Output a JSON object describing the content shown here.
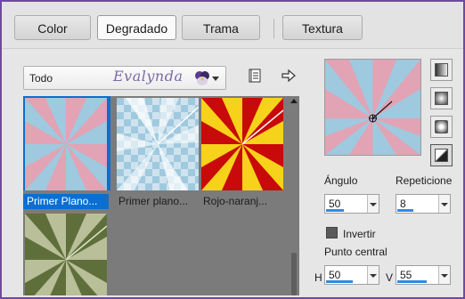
{
  "tabs": [
    {
      "label": "Color",
      "active": false
    },
    {
      "label": "Degradado",
      "active": true
    },
    {
      "label": "Trama",
      "active": false
    },
    {
      "label": "Textura",
      "active": false
    }
  ],
  "category_select": {
    "value": "Todo",
    "logo_text": "Evalynda"
  },
  "icons": {
    "book": "book-icon",
    "export": "arrow-right-icon"
  },
  "gallery": {
    "items": [
      {
        "caption": "Primer Plano...",
        "selected": true
      },
      {
        "caption": "Primer plano...",
        "selected": false
      },
      {
        "caption": "Rojo-naranj...",
        "selected": false
      },
      {
        "caption": "",
        "selected": false
      }
    ]
  },
  "controls": {
    "angle_label": "Ángulo",
    "angle_value": "50",
    "repeat_label": "Repeticione",
    "repeat_value": "8",
    "invert_label": "Invertir",
    "invert_checked": true,
    "center_label": "Punto central",
    "h_label": "H",
    "h_value": "50",
    "v_label": "V",
    "v_value": "55"
  },
  "colors": {
    "accent": "#0a6fd1",
    "frame": "#6d4aa0",
    "pink": "#e2a3b4",
    "blue": "#9fc9df"
  }
}
